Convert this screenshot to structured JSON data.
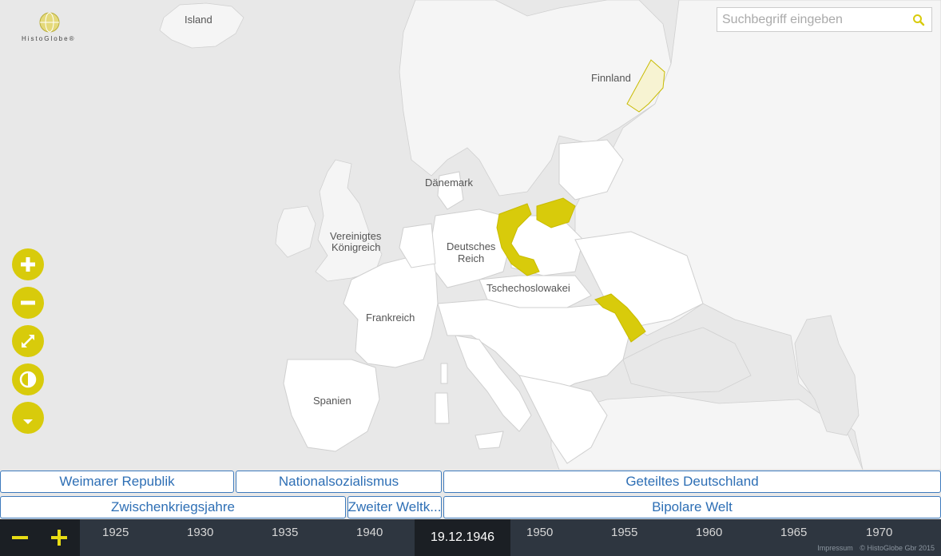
{
  "app": {
    "logo_text": "HistoGlobe®"
  },
  "search": {
    "placeholder": "Suchbegriff eingeben"
  },
  "map": {
    "labels": {
      "island": "Island",
      "finnland": "Finnland",
      "daenemark": "Dänemark",
      "uk_1": "Vereinigtes",
      "uk_2": "Königreich",
      "de_1": "Deutsches",
      "de_2": "Reich",
      "cz": "Tschechoslowakei",
      "fr": "Frankreich",
      "es": "Spanien"
    },
    "colors": {
      "water": "#e8e8e8",
      "land": "#ffffff",
      "highlight": "#d8cb0b",
      "highlight_light": "#f7f3d2",
      "border": "#c8c8c8"
    }
  },
  "controls": [
    {
      "name": "zoom-in-button",
      "icon": "plus-icon"
    },
    {
      "name": "zoom-out-button",
      "icon": "minus-icon"
    },
    {
      "name": "fullscreen-button",
      "icon": "expand-icon"
    },
    {
      "name": "contrast-button",
      "icon": "contrast-icon"
    },
    {
      "name": "more-button",
      "icon": "caret-down-icon"
    }
  ],
  "epochs": {
    "row1": [
      "Weimarer Republik",
      "Nationalsozialismus",
      "Geteiltes Deutschland"
    ],
    "row2": [
      "Zwischenkriegsjahre",
      "Zweiter Weltk...",
      "Bipolare Welt"
    ]
  },
  "timeline": {
    "years": [
      "1925",
      "1930",
      "1935",
      "1940",
      "1950",
      "1955",
      "1960",
      "1965",
      "1970"
    ],
    "current_date": "19.12.1946",
    "zoom_out_icon": "minus-icon",
    "zoom_in_icon": "plus-icon"
  },
  "footer": {
    "impressum": "Impressum",
    "copyright": "© HistoGlobe Gbr 2015"
  }
}
